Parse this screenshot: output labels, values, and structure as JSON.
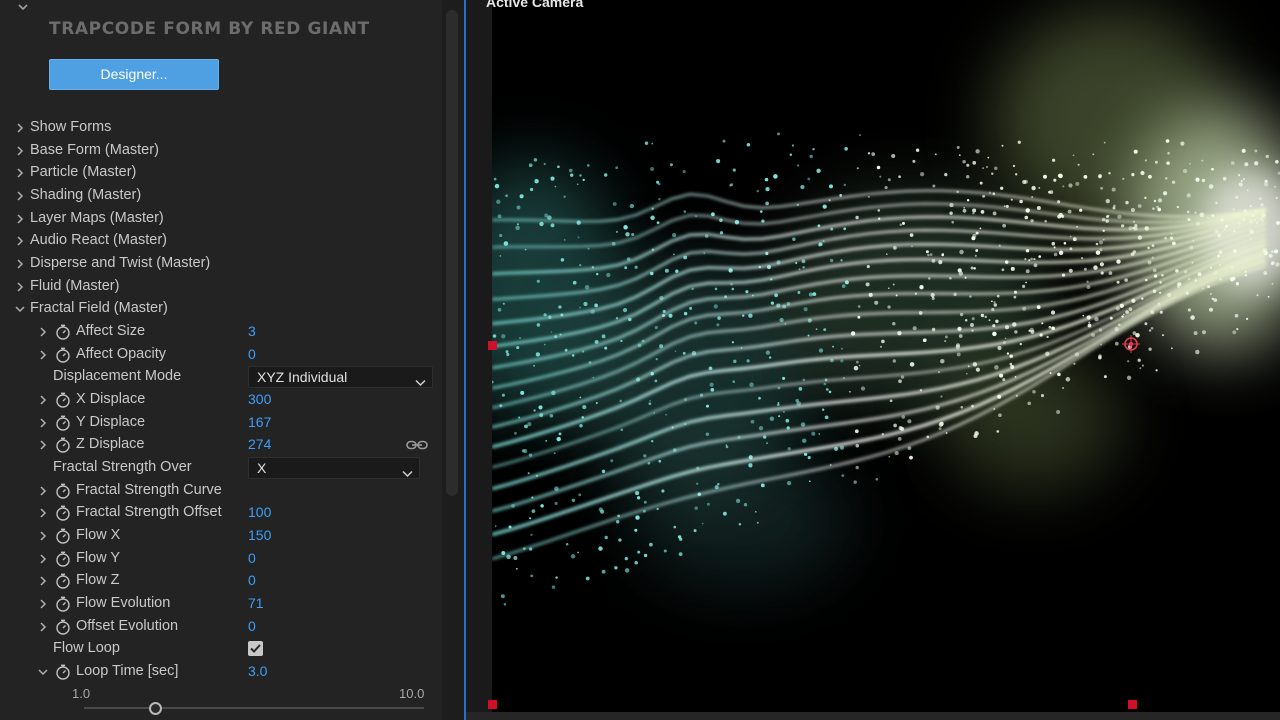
{
  "effect_controls": {
    "plugin_title": "TRAPCODE FORM BY RED GIANT",
    "designer_button": "Designer...",
    "groups": [
      {
        "label": "Show Forms"
      },
      {
        "label": "Base Form (Master)"
      },
      {
        "label": "Particle (Master)"
      },
      {
        "label": "Shading (Master)"
      },
      {
        "label": "Layer Maps (Master)"
      },
      {
        "label": "Audio React (Master)"
      },
      {
        "label": "Disperse and Twist (Master)"
      },
      {
        "label": "Fluid (Master)"
      },
      {
        "label": "Fractal Field (Master)"
      }
    ],
    "fractal_field": {
      "affect_size": {
        "label": "Affect Size",
        "value": "3"
      },
      "affect_opacity": {
        "label": "Affect Opacity",
        "value": "0"
      },
      "displacement_mode": {
        "label": "Displacement Mode",
        "value": "XYZ Individual"
      },
      "x_displace": {
        "label": "X Displace",
        "value": "300"
      },
      "y_displace": {
        "label": "Y Displace",
        "value": "167"
      },
      "z_displace": {
        "label": "Z Displace",
        "value": "274"
      },
      "fractal_strength_over": {
        "label": "Fractal Strength Over",
        "value": "X"
      },
      "fractal_strength_curve": {
        "label": "Fractal Strength Curve"
      },
      "fractal_strength_offset": {
        "label": "Fractal Strength Offset",
        "value": "100"
      },
      "flow_x": {
        "label": "Flow X",
        "value": "150"
      },
      "flow_y": {
        "label": "Flow Y",
        "value": "0"
      },
      "flow_z": {
        "label": "Flow Z",
        "value": "0"
      },
      "flow_evolution": {
        "label": "Flow Evolution",
        "value": "71"
      },
      "offset_evolution": {
        "label": "Offset Evolution",
        "value": "0"
      },
      "flow_loop": {
        "label": "Flow Loop",
        "checked": true
      },
      "loop_time": {
        "label": "Loop Time [sec]",
        "value": "3.0",
        "slider_min": "1.0",
        "slider_max": "10.0",
        "slider_fraction": 0.22
      }
    }
  },
  "viewer": {
    "label": "Active Camera"
  },
  "colors": {
    "accent_blue": "#3f9ef5",
    "button_blue": "#4f9fe3",
    "handle_red": "#d0102a",
    "particle_cyan": "#7fe8e0",
    "particle_white": "#f4fff0"
  }
}
